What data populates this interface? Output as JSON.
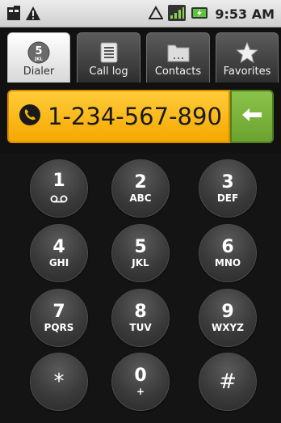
{
  "status_bar": {
    "time": "9:53 AM",
    "icons": [
      "sd-card-icon",
      "warning-icon",
      "data-icon",
      "signal-icon",
      "battery-icon"
    ]
  },
  "tabs": [
    {
      "label": "Dialer",
      "icon": "dialer-keypad-icon",
      "icon_digit": "5",
      "icon_letters": "JKL",
      "active": true
    },
    {
      "label": "Call log",
      "icon": "call-log-icon",
      "active": false
    },
    {
      "label": "Contacts",
      "icon": "contacts-icon",
      "active": false
    },
    {
      "label": "Favorites",
      "icon": "star-icon",
      "active": false
    }
  ],
  "dialer": {
    "number": "1-234-567-890",
    "field_color": "#f5b400",
    "backspace_color": "#7cb33a"
  },
  "keypad": {
    "keys": [
      {
        "digit": "1",
        "letters": ""
      },
      {
        "digit": "2",
        "letters": "ABC"
      },
      {
        "digit": "3",
        "letters": "DEF"
      },
      {
        "digit": "4",
        "letters": "GHI"
      },
      {
        "digit": "5",
        "letters": "JKL"
      },
      {
        "digit": "6",
        "letters": "MNO"
      },
      {
        "digit": "7",
        "letters": "PQRS"
      },
      {
        "digit": "8",
        "letters": "TUV"
      },
      {
        "digit": "9",
        "letters": "WXYZ"
      },
      {
        "digit": "*",
        "letters": ""
      },
      {
        "digit": "0",
        "letters": "+"
      },
      {
        "digit": "#",
        "letters": ""
      }
    ]
  }
}
